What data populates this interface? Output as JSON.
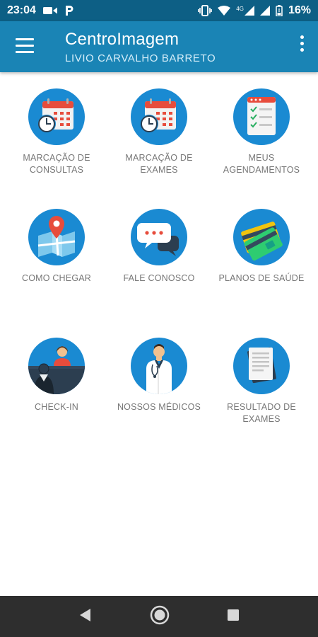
{
  "status_bar": {
    "time": "23:04",
    "network": "4G",
    "battery": "16%"
  },
  "app_bar": {
    "title": "CentroImagem",
    "subtitle": "LIVIO CARVALHO BARRETO"
  },
  "tiles": [
    {
      "label_1": "MARCAÇÃO DE",
      "label_2": "CONSULTAS",
      "icon": "calendar-clock-icon"
    },
    {
      "label_1": "MARCAÇÃO DE",
      "label_2": "EXAMES",
      "icon": "calendar-clock-icon"
    },
    {
      "label_1": "MEUS",
      "label_2": "AGENDAMENTOS",
      "icon": "checklist-icon"
    },
    {
      "label_1": "COMO CHEGAR",
      "label_2": "",
      "icon": "map-pin-icon"
    },
    {
      "label_1": "FALE CONOSCO",
      "label_2": "",
      "icon": "chat-bubbles-icon"
    },
    {
      "label_1": "PLANOS DE SAÚDE",
      "label_2": "",
      "icon": "health-cards-icon"
    },
    {
      "label_1": "CHECK-IN",
      "label_2": "",
      "icon": "reception-desk-icon"
    },
    {
      "label_1": "NOSSOS MÉDICOS",
      "label_2": "",
      "icon": "doctor-icon"
    },
    {
      "label_1": "RESULTADO DE",
      "label_2": "EXAMES",
      "icon": "documents-icon"
    }
  ],
  "nav_bar": {
    "back_icon": "back-triangle-icon",
    "home_icon": "home-circle-icon",
    "recents_icon": "recents-square-icon"
  }
}
